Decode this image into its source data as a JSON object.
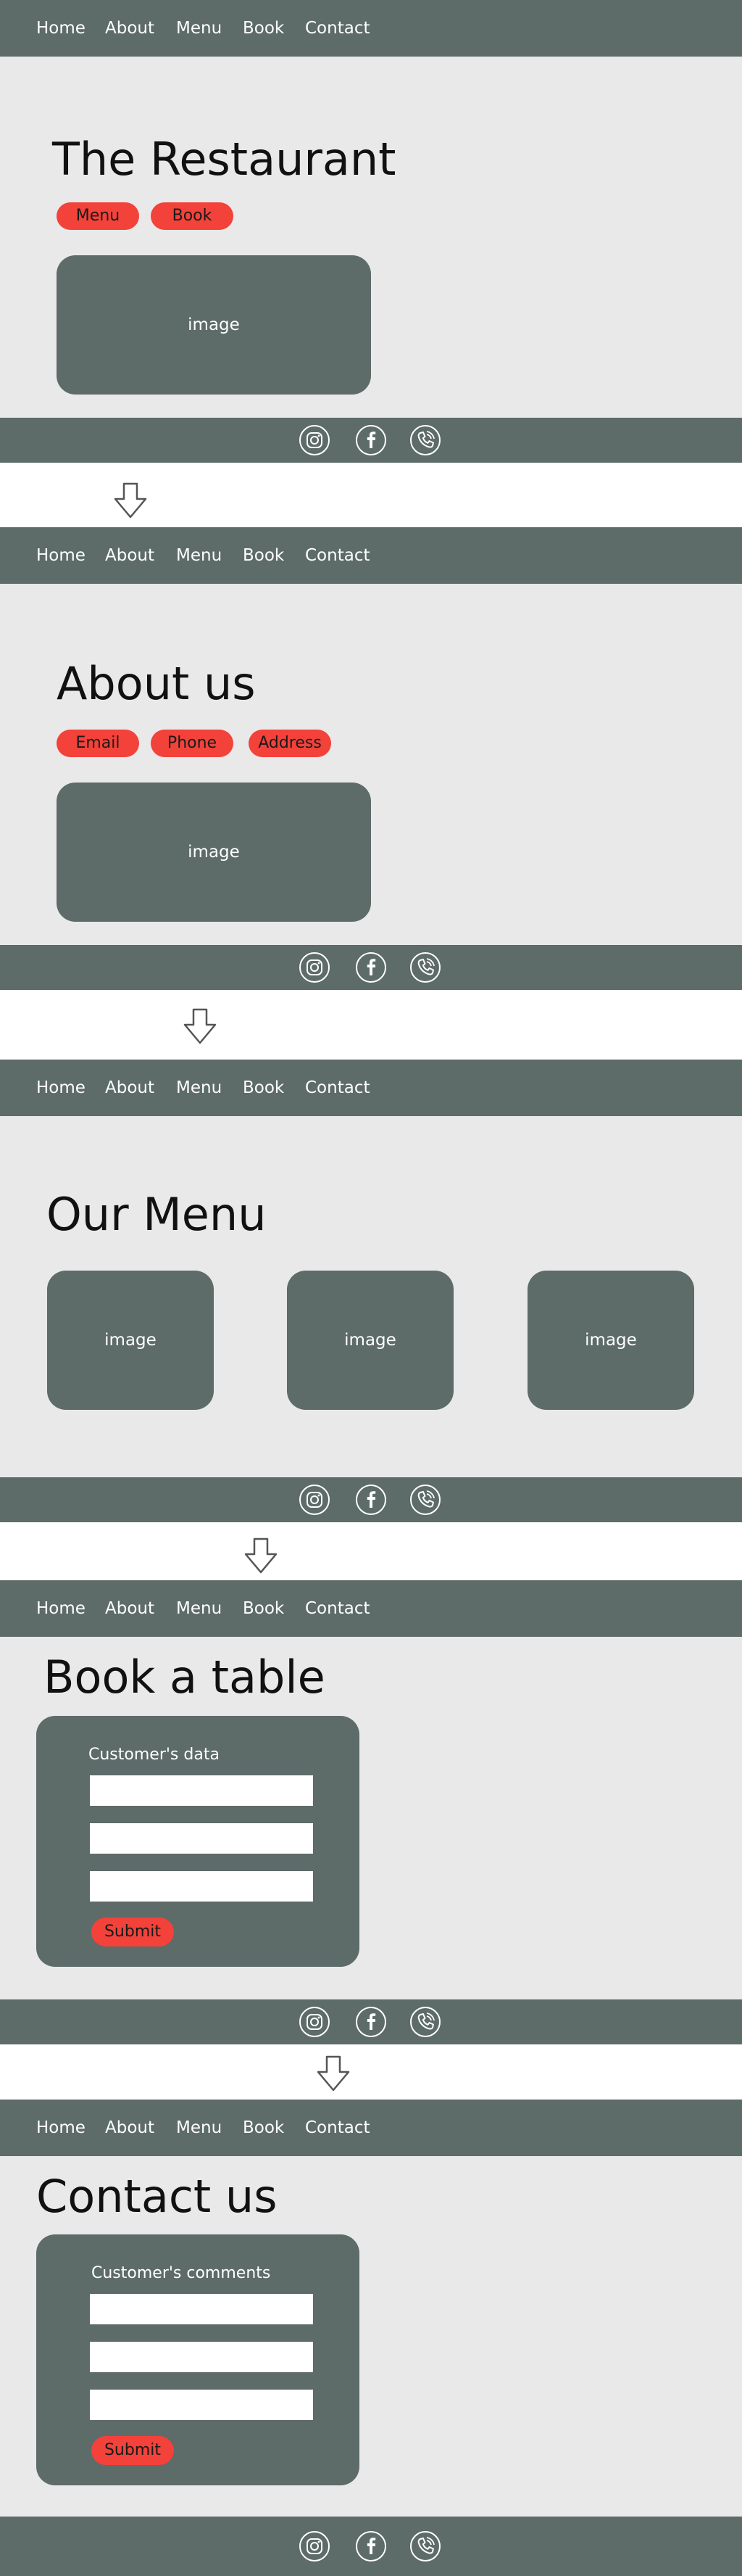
{
  "nav": {
    "items": [
      "Home",
      "About",
      "Menu",
      "Book",
      "Contact"
    ]
  },
  "icons": {
    "social": [
      "instagram-icon",
      "facebook-icon",
      "phone-icon"
    ],
    "arrow": "down-arrow-icon"
  },
  "colors": {
    "bar": "#5d6b69",
    "section_bg": "#e9e9e9",
    "accent": "#f2423a",
    "text": "#111111"
  },
  "sections": {
    "restaurant": {
      "title": "The Restaurant",
      "buttons": [
        "Menu",
        "Book"
      ],
      "image_label": "image"
    },
    "about": {
      "title": "About us",
      "buttons": [
        "Email",
        "Phone",
        "Address"
      ],
      "image_label": "image"
    },
    "menu": {
      "title": "Our Menu",
      "image_labels": [
        "image",
        "image",
        "image"
      ]
    },
    "book": {
      "title": "Book a table",
      "form_label": "Customer's data",
      "submit": "Submit"
    },
    "contact": {
      "title": "Contact us",
      "form_label": "Customer's comments",
      "submit": "Submit"
    }
  }
}
